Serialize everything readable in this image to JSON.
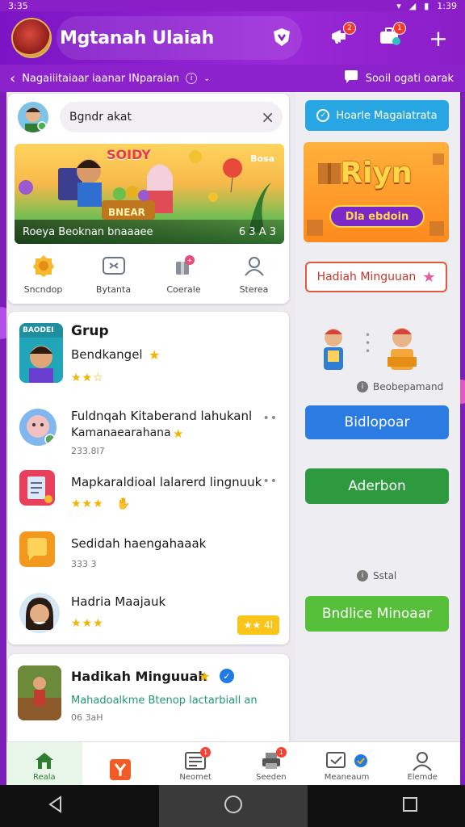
{
  "status_bar": {
    "time": "3:35",
    "right_time": "1:39"
  },
  "app_bar": {
    "title": "Mgtanah Ulaiah",
    "notification_badge": "2",
    "inbox_badge": "1",
    "plus_label": "+"
  },
  "sub_bar": {
    "breadcrumb": "Nagaiiitaiaar iaanar INparaian",
    "info_label": "i",
    "right_label": "Sooil ogati oarak"
  },
  "search_card": {
    "search_value": "Bgndr akat",
    "banner_caption": "Roeya Beoknan bnaaaee",
    "banner_counter": "6 3 A 3",
    "banner_tag": "Bosa",
    "banner_sign": "SOIDY",
    "banner_board": "BNEAR",
    "quick_actions": [
      "Sncndop",
      "Bytanta",
      "Coerale",
      "Sterea"
    ]
  },
  "list": {
    "items": [
      {
        "title": "Grup",
        "subtitle": "Bendkangel",
        "stars": "★★☆",
        "icon_tag": "BAODEI"
      },
      {
        "title": "Fuldnqah Kitaberand lahukanl",
        "subtitle": "Kamanaearahana",
        "meta": "233.8I7"
      },
      {
        "title": "Mapkaraldioal lalarerd lingnuuk",
        "stars": "★★★"
      },
      {
        "title": "Sedidah haengahaaak",
        "meta": "333 3"
      },
      {
        "title": "Hadria Maajauk",
        "stars": "★★★",
        "chip": "★★ 4l"
      }
    ],
    "more_dots": "••"
  },
  "group_card": {
    "title": "Hadikah Minguuah",
    "subtitle": "Mahadoalkme Btenop lactarbiall an",
    "meta": "06 3aH"
  },
  "right_panel": {
    "top_button": "Hoarle Magalatrata",
    "reward_title": "Riyn",
    "reward_pill": "Dla ebdoin",
    "outline_button": "Hadiah Minguuan",
    "note_1": "Beobepamand",
    "button_blue": "Bidlopoar",
    "button_green": "Aderbon",
    "note_2": "Sstal",
    "button_lime": "Bndlice Minoaar"
  },
  "tab_bar": {
    "tabs": [
      {
        "label": "Reala"
      },
      {
        "label": ""
      },
      {
        "label": "Neomet",
        "badge": "1"
      },
      {
        "label": "Seeden",
        "badge": "1"
      },
      {
        "label": "Meaneaum"
      },
      {
        "label": "Elemde"
      }
    ]
  },
  "colors": {
    "brand_purple": "#8a1ec7",
    "accent_blue": "#1e7be4",
    "accent_green": "#2e9a3f",
    "accent_lime": "#52bf3a",
    "star": "#f4b400"
  }
}
